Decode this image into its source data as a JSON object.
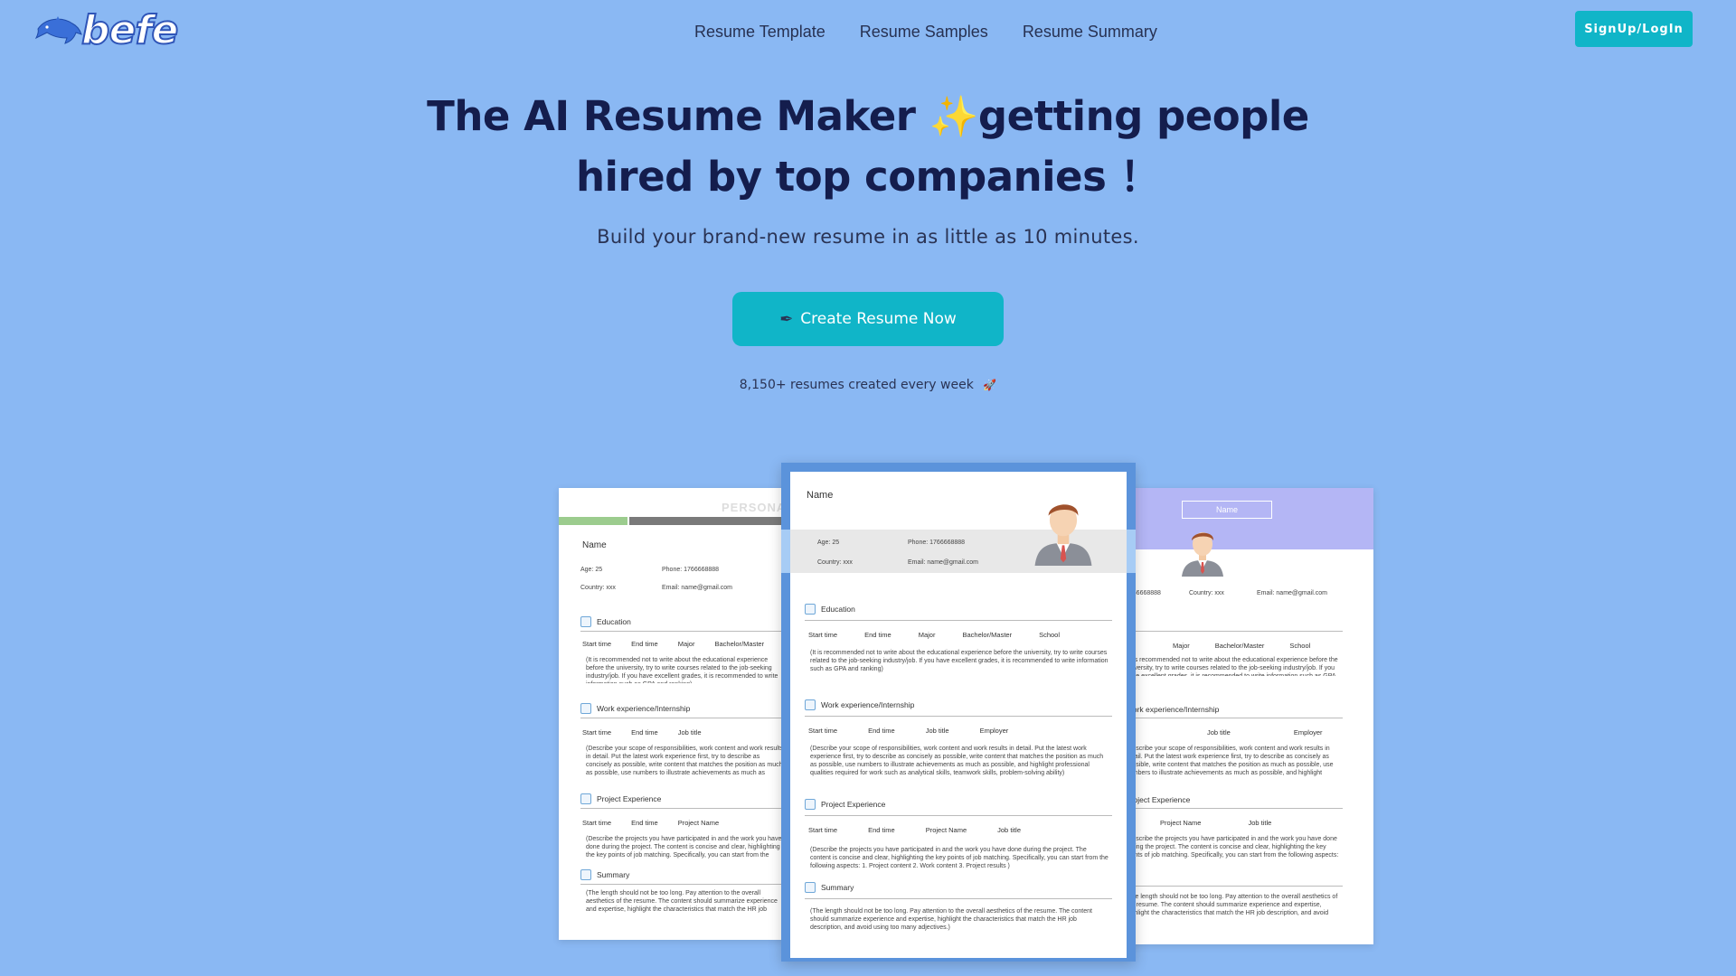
{
  "header": {
    "logo_text": "befe",
    "nav": [
      "Resume Template",
      "Resume Samples",
      "Resume Summary"
    ],
    "signup_label": "SignUp/LogIn"
  },
  "hero": {
    "title_line1_a": "The AI  Resume Maker ",
    "sparkle": "✨",
    "title_line1_b": "getting people",
    "title_line2": "hired by top companies ！",
    "subtitle": "Build your brand-new resume in as little as 10 minutes.",
    "cta_icon": "✒",
    "cta_label": "Create Resume Now",
    "stat": "8,150+ resumes created every week",
    "stat_icon": "🚀"
  },
  "resume": {
    "personal_label": "PERSONAL",
    "name": "Name",
    "age_label": "Age:",
    "age": "25",
    "phone_label": "Phone:",
    "phone": "1766668888",
    "country_label": "Country:",
    "country": "xxx",
    "email_label": "Email:",
    "email": "name@gmail.com",
    "education": "Education",
    "start_time": "Start time",
    "dash": "–",
    "end_time": "End time",
    "major": "Major",
    "degree": "Bachelor/Master",
    "school": "School",
    "education_note": "(It is recommended not to write about the educational experience before the university, try to write courses related to the job-seeking industry/job. If you have excellent grades, it is recommended to write information such as GPA and ranking)",
    "work": "Work experience/Internship",
    "job_title": "Job title",
    "employer": "Employer",
    "work_note": "(Describe your scope of responsibilities, work content and work results in detail. Put the latest work experience first, try to describe as concisely as possible, write content that matches the position as much as possible, use numbers to illustrate achievements as much as possible, and highlight professional qualities required for work such as analytical skills, teamwork skills, problem-solving ability)",
    "project": "Project Experience",
    "project_name": "Project Name",
    "project_note": "(Describe the projects you have participated in and the work you have done during the project. The content is concise and clear, highlighting the key points of job matching. Specifically, you can start from the following aspects: 1. Project content 2. Work content 3. Project results )",
    "summary": "Summary",
    "summary_note": "(The length should not be too long. Pay attention to the overall aesthetics of the resume. The content should summarize experience and expertise, highlight the characteristics that match the HR job description, and avoid using too many adjectives.)"
  },
  "colors": {
    "background": "#8ab8f3",
    "accent": "#10b5c8",
    "title": "#141d4d",
    "center_frame": "#5b93db",
    "right_header": "#b4b6f5"
  }
}
